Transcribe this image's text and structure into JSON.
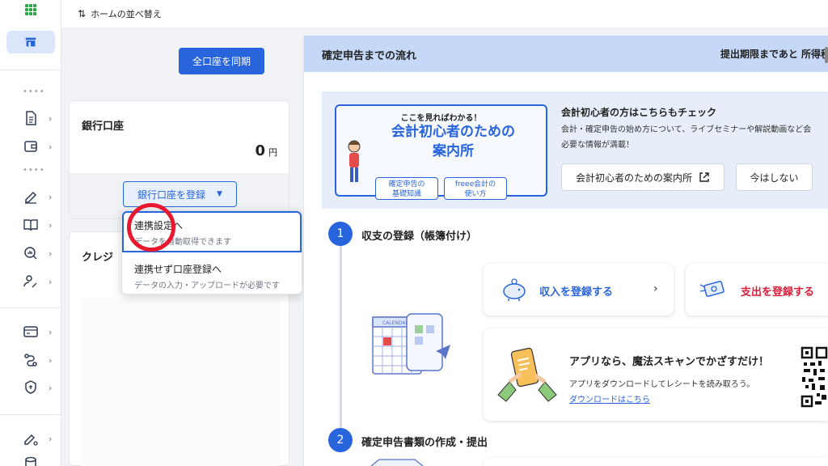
{
  "topbar": {
    "sort_label": "ホームの並べ替え"
  },
  "accounts": {
    "sync_label": "全口座を同期",
    "bank": {
      "title": "銀行口座",
      "amount": "0",
      "currency": "円",
      "register_label": "銀行口座を登録"
    },
    "credit": {
      "title": "クレジ"
    }
  },
  "dropdown": {
    "items": [
      {
        "label": "連携設定へ",
        "sub": "データを自動取得できます"
      },
      {
        "label": "連携せず口座登録へ",
        "sub": "データの入力・アップロードが必要です"
      }
    ]
  },
  "flow": {
    "title": "確定申告までの流れ",
    "deadline": "提出期限まであと 所得税",
    "promo": {
      "kicker": "ここを見ればわかる！",
      "headline_1": "会計初心者のための",
      "headline_2": "案内所",
      "tag_a_1": "確定申告の",
      "tag_a_2": "基礎知識",
      "tag_b_1": "freee会計の",
      "tag_b_2": "使い方",
      "title": "会計初心者の方はこちらもチェック",
      "desc_1": "会計・確定申告の始め方について、ライブセミナーや解説動画など会",
      "desc_2": "必要な情報が満載！",
      "guide_label": "会計初心者のための案内所",
      "later_label": "今はしない"
    },
    "steps": [
      {
        "num": "1",
        "title": "収支の登録（帳簿付け）"
      },
      {
        "num": "2",
        "title": "確定申告書類の作成・提出"
      }
    ],
    "income_label": "収入を登録する",
    "expense_label": "支出を登録する",
    "calendar_label": "CALENDAR",
    "app": {
      "headline": "アプリなら、魔法スキャンでかざすだけ！",
      "desc": "アプリをダウンロードしてレシートを読み取ろう。",
      "link": "ダウンロードはこちら"
    }
  },
  "colors": {
    "accent": "#2864dc",
    "expense": "#d8203a",
    "header_band": "#c5d8f7",
    "cursor_ring": "#e8192f"
  }
}
